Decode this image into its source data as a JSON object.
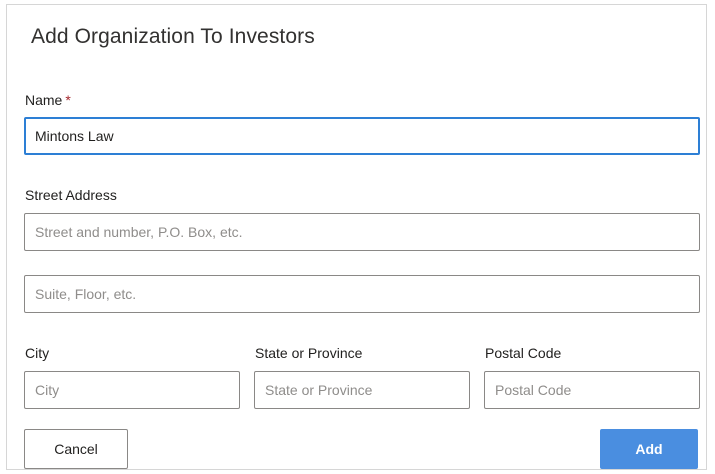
{
  "dialog": {
    "title": "Add Organization To Investors"
  },
  "form": {
    "name_label": "Name",
    "required_marker": "*",
    "name_value": "Mintons Law",
    "street_label": "Street Address",
    "street1_placeholder": "Street and number, P.O. Box, etc.",
    "street2_placeholder": "Suite, Floor, etc.",
    "city_label": "City",
    "city_placeholder": "City",
    "state_label": "State or Province",
    "state_placeholder": "State or Province",
    "postal_label": "Postal Code",
    "postal_placeholder": "Postal Code"
  },
  "actions": {
    "cancel_label": "Cancel",
    "add_label": "Add"
  },
  "colors": {
    "accent": "#4a8ee0",
    "focus_border": "#2d7fd5",
    "required": "#a4262c"
  }
}
